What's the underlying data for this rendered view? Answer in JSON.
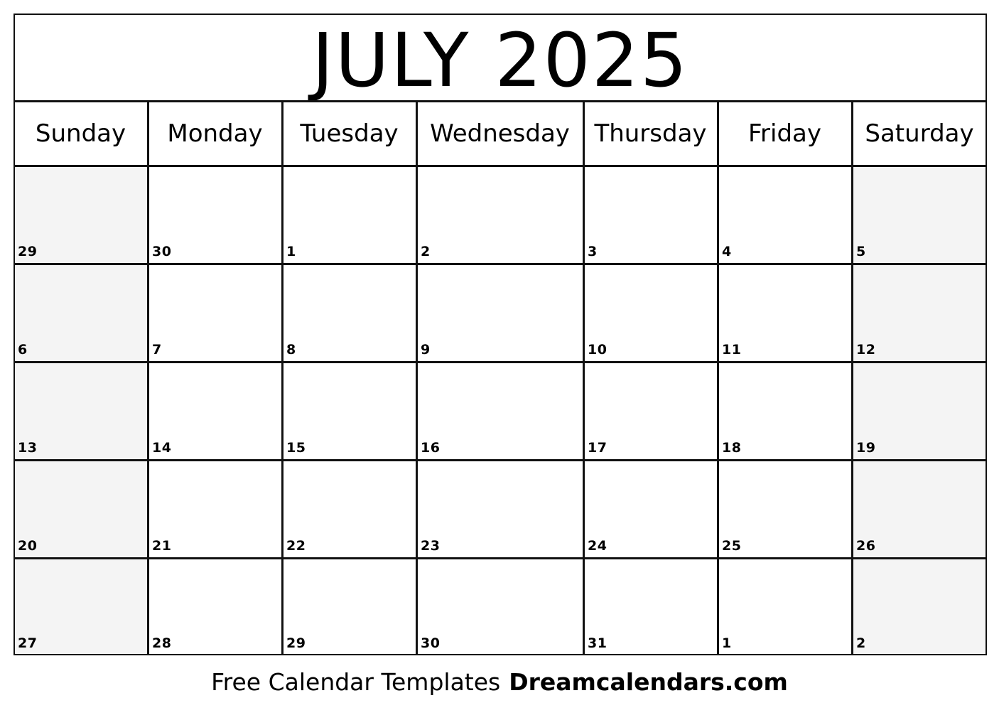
{
  "calendar": {
    "title": "JULY 2025",
    "weekdays": [
      "Sunday",
      "Monday",
      "Tuesday",
      "Wednesday",
      "Thursday",
      "Friday",
      "Saturday"
    ],
    "weeks": [
      [
        "29",
        "30",
        "1",
        "2",
        "3",
        "4",
        "5"
      ],
      [
        "6",
        "7",
        "8",
        "9",
        "10",
        "11",
        "12"
      ],
      [
        "13",
        "14",
        "15",
        "16",
        "17",
        "18",
        "19"
      ],
      [
        "20",
        "21",
        "22",
        "23",
        "24",
        "25",
        "26"
      ],
      [
        "27",
        "28",
        "29",
        "30",
        "31",
        "1",
        "2"
      ]
    ],
    "weekend_shade_color": "#f4f4f4",
    "line_color": "#111111"
  },
  "footer": {
    "text": "Free Calendar Templates",
    "brand": "Dreamcalendars.com"
  }
}
